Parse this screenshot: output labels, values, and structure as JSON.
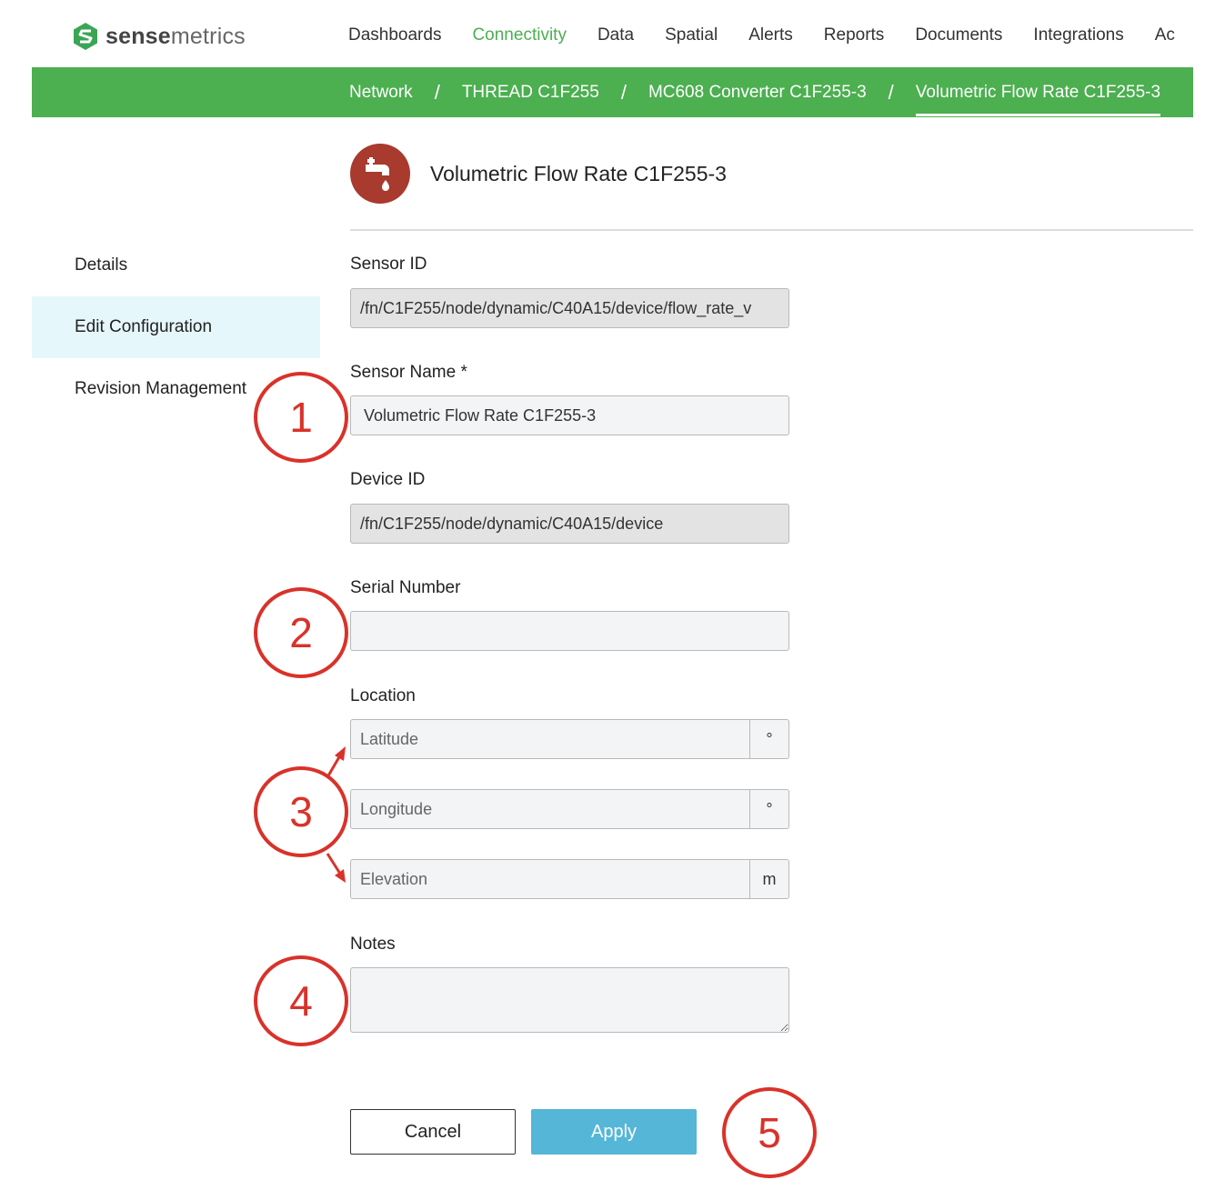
{
  "brand": {
    "name_bold": "sense",
    "name_light": "metrics"
  },
  "nav": {
    "items": [
      "Dashboards",
      "Connectivity",
      "Data",
      "Spatial",
      "Alerts",
      "Reports",
      "Documents",
      "Integrations",
      "Ac"
    ],
    "active": "Connectivity"
  },
  "breadcrumb": [
    "Network",
    "THREAD C1F255",
    "MC608 Converter C1F255-3",
    "Volumetric Flow Rate C1F255-3"
  ],
  "breadcrumb_separator": "/",
  "sidebar": {
    "items": [
      "Details",
      "Edit Configuration",
      "Revision Management"
    ],
    "active": "Edit Configuration"
  },
  "header": {
    "title": "Volumetric Flow Rate C1F255-3",
    "icon": "faucet-icon",
    "icon_color": "#a83a2e"
  },
  "form": {
    "sensor_id": {
      "label": "Sensor ID",
      "value": "/fn/C1F255/node/dynamic/C40A15/device/flow_rate_v"
    },
    "sensor_name": {
      "label": "Sensor Name *",
      "value": "Volumetric Flow Rate C1F255-3"
    },
    "device_id": {
      "label": "Device ID",
      "value": "/fn/C1F255/node/dynamic/C40A15/device"
    },
    "serial_number": {
      "label": "Serial Number",
      "value": ""
    },
    "location": {
      "label": "Location",
      "latitude": {
        "placeholder": "Latitude",
        "unit": "°"
      },
      "longitude": {
        "placeholder": "Longitude",
        "unit": "°"
      },
      "elevation": {
        "placeholder": "Elevation",
        "unit": "m"
      }
    },
    "notes": {
      "label": "Notes",
      "value": ""
    }
  },
  "buttons": {
    "cancel": "Cancel",
    "apply": "Apply"
  },
  "annotations": [
    "1",
    "2",
    "3",
    "4",
    "5"
  ],
  "colors": {
    "brand_green": "#4caf50",
    "apply_blue": "#55b6d8",
    "annotation_red": "#d9322a",
    "active_sidebar": "#e6f7fb"
  }
}
